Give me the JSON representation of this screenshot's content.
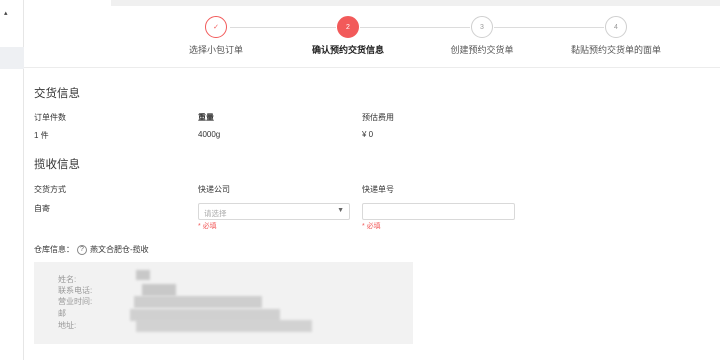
{
  "sidebar": {
    "caret": "▴"
  },
  "steps": [
    {
      "number": "✓",
      "label": "选择小包订单",
      "state": "done"
    },
    {
      "number": "2",
      "label": "确认预约交货信息",
      "state": "active"
    },
    {
      "number": "3",
      "label": "创建预约交货单",
      "state": "todo"
    },
    {
      "number": "4",
      "label": "黏贴预约交货单的面单",
      "state": "todo"
    }
  ],
  "delivery": {
    "title": "交货信息",
    "count_label": "订单件数",
    "count_value": "1 件",
    "weight_label": "重量",
    "weight_value": "4000g",
    "fee_label": "预估费用",
    "fee_value": "¥ 0"
  },
  "pickup": {
    "title": "揽收信息",
    "method_label": "交货方式",
    "method_value": "自寄",
    "company_label": "快递公司",
    "company_placeholder": "请选择",
    "tracking_label": "快递单号",
    "required_text": "* 必填"
  },
  "warehouse": {
    "label": "仓库信息：",
    "help_icon": "?",
    "name": "燕文合肥仓-揽收",
    "lines": [
      "姓名:",
      "联系电话:",
      "营业时间:",
      "邮",
      "地址:"
    ]
  }
}
